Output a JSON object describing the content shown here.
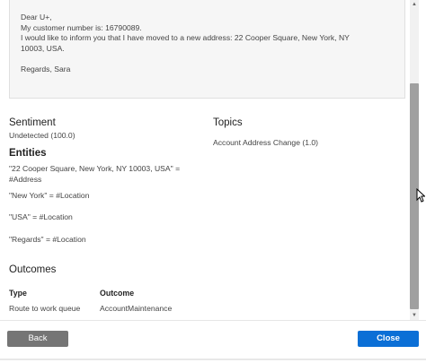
{
  "message": {
    "lines": [
      "Dear U+,",
      "My customer number is: 16790089.",
      "I would like to inform you that I have moved to a new address: 22 Cooper Square, New York, NY",
      "10003, USA.",
      "",
      "Regards, Sara"
    ]
  },
  "sentiment": {
    "heading": "Sentiment",
    "value": "Undetected (100.0)"
  },
  "topics": {
    "heading": "Topics",
    "value": "Account Address Change (1.0)"
  },
  "entities": {
    "heading": "Entities",
    "items": [
      {
        "line1": "\"22 Cooper Square, New York, NY 10003, USA\" =",
        "line2": "#Address"
      },
      {
        "line1": "\"New York\" = #Location"
      },
      {
        "line1": "\"USA\" = #Location"
      },
      {
        "line1": "\"Regards\" = #Location"
      }
    ]
  },
  "outcomes": {
    "heading": "Outcomes",
    "columns": [
      "Type",
      "Outcome"
    ],
    "rows": [
      [
        "Route to work queue",
        "AccountMaintenance"
      ]
    ]
  },
  "buttons": {
    "back": "Back",
    "close": "Close"
  },
  "icons": {
    "cursor": "mouse-pointer-icon",
    "scroll_up": "chevron-up-icon",
    "scroll_down": "chevron-down-icon"
  }
}
